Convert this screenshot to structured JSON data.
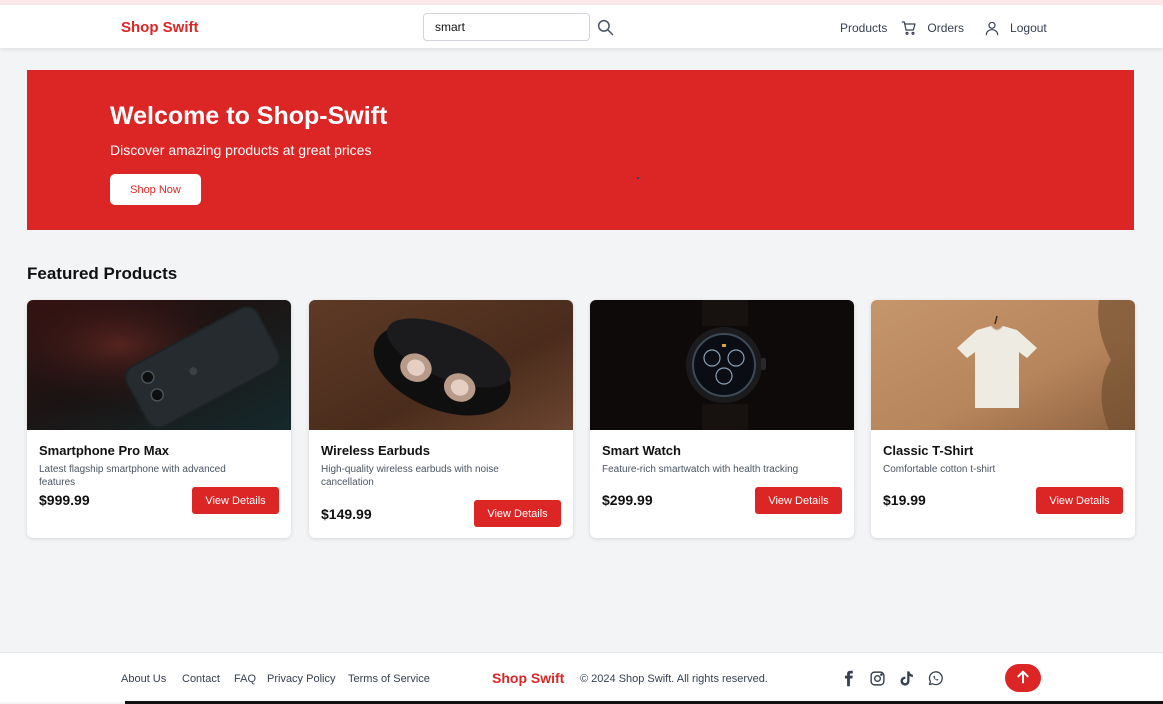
{
  "header": {
    "brand": "Shop Swift",
    "search": {
      "value": "smart",
      "placeholder": ""
    },
    "nav": {
      "products": "Products",
      "orders": "Orders",
      "logout": "Logout"
    }
  },
  "hero": {
    "title": "Welcome to Shop-Swift",
    "subtitle": "Discover amazing products at great prices",
    "cta": "Shop Now"
  },
  "featured": {
    "title": "Featured Products",
    "products": [
      {
        "name": "Smartphone Pro Max",
        "description": "Latest flagship smartphone with advanced features",
        "price": "$999.99",
        "button": "View Details"
      },
      {
        "name": "Wireless Earbuds",
        "description": "High-quality wireless earbuds with noise cancellation",
        "price": "$149.99",
        "button": "View Details"
      },
      {
        "name": "Smart Watch",
        "description": "Feature-rich smartwatch with health tracking",
        "price": "$299.99",
        "button": "View Details"
      },
      {
        "name": "Classic T-Shirt",
        "description": "Comfortable cotton t-shirt",
        "price": "$19.99",
        "button": "View Details"
      }
    ]
  },
  "footer": {
    "links": [
      "About Us",
      "Contact",
      "FAQ",
      "Privacy Policy",
      "Terms of Service"
    ],
    "brand": "Shop Swift",
    "copyright": "© 2024 Shop Swift. All rights reserved.",
    "social_icons": [
      "facebook-icon",
      "instagram-icon",
      "tiktok-icon",
      "whatsapp-icon"
    ]
  },
  "colors": {
    "accent": "#dc2626",
    "background": "#f3f4f6"
  }
}
